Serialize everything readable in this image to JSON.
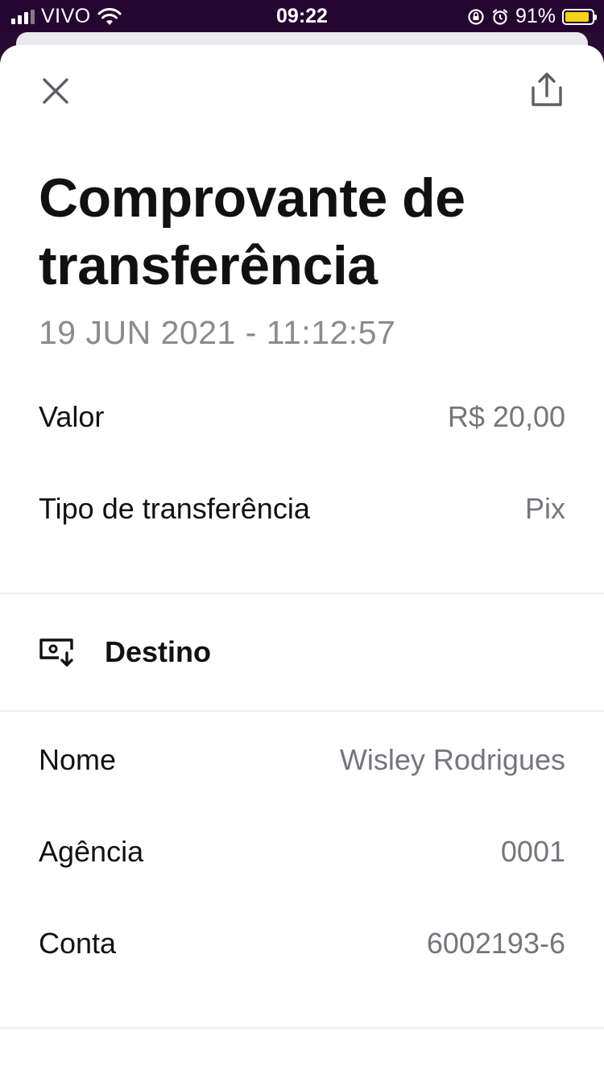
{
  "status_bar": {
    "carrier": "VIVO",
    "time": "09:22",
    "battery": "91%",
    "battery_level": 0.91,
    "battery_color": "#f7d21b"
  },
  "header": {
    "close_icon": "close-icon",
    "share_icon": "share-icon"
  },
  "receipt": {
    "title": "Comprovante de transferência",
    "date": "19 JUN 2021 - 11:12:57",
    "valor_label": "Valor",
    "valor_value": "R$ 20,00",
    "tipo_label": "Tipo de transferência",
    "tipo_value": "Pix"
  },
  "destino": {
    "section_label": "Destino",
    "icon": "destination-icon",
    "nome_label": "Nome",
    "nome_value": "Wisley Rodrigues",
    "agencia_label": "Agência",
    "agencia_value": "0001",
    "conta_label": "Conta",
    "conta_value": "6002193-6"
  }
}
